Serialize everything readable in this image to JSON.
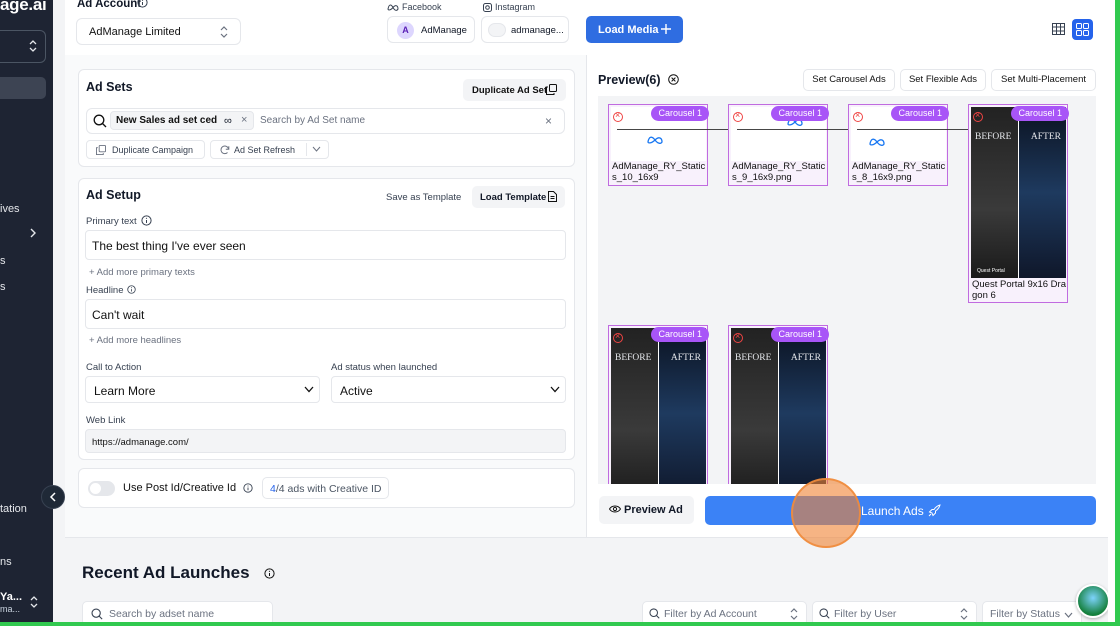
{
  "sidebar": {
    "logo": "age.ai",
    "nav_items": [
      {
        "label": "ives"
      },
      {
        "label": "s"
      },
      {
        "label": "s"
      },
      {
        "label": "tation"
      },
      {
        "label": "ns"
      }
    ],
    "profile_name": "Ya...",
    "profile_sub": "ma..."
  },
  "topbar": {
    "ad_account_label": "Ad Account",
    "ad_account_value": "AdManage Limited",
    "facebook_label": "Facebook",
    "instagram_label": "Instagram",
    "facebook_page": "AdManage",
    "instagram_account": "admanage...",
    "load_media": "Load Media"
  },
  "ad_sets": {
    "title": "Ad Sets",
    "duplicate_button": "Duplicate Ad Set",
    "selected_tag": "New Sales ad set ced",
    "search_placeholder": "Search by Ad Set name",
    "duplicate_campaign": "Duplicate Campaign",
    "refresh": "Ad Set Refresh"
  },
  "ad_setup": {
    "title": "Ad Setup",
    "save_template": "Save as Template",
    "load_template": "Load Template",
    "primary_text_label": "Primary text",
    "primary_text_value": "The best thing I've ever seen",
    "add_primary": "+ Add more primary texts",
    "headline_label": "Headline",
    "headline_value": "Can't wait",
    "add_headline": "+ Add more headlines",
    "cta_label": "Call to Action",
    "cta_value": "Learn More",
    "status_label": "Ad status when launched",
    "status_value": "Active",
    "weblink_label": "Web Link",
    "weblink_value": "https://admanage.com/"
  },
  "post_id": {
    "label": "Use Post Id/Creative Id",
    "count": "4",
    "total": "/4",
    "suffix": " ads with Creative ID",
    "toggle_on": false
  },
  "preview": {
    "title": "Preview(6)",
    "set_carousel": "Set Carousel Ads",
    "set_flexible": "Set Flexible Ads",
    "set_multi": "Set Multi-Placement",
    "tiles": [
      {
        "badge": "Carousel 1",
        "caption": "AdManage_RY_Static s_10_16x9",
        "kind": "meta"
      },
      {
        "badge": "Carousel 1",
        "caption": "AdManage_RY_Static s_9_16x9.png",
        "kind": "meta"
      },
      {
        "badge": "Carousel 1",
        "caption": "AdManage_RY_Static s_8_16x9.png",
        "kind": "meta"
      },
      {
        "badge": "Carousel 1",
        "caption": "Quest Portal 9x16 Dragon 6",
        "kind": "beforeafter"
      },
      {
        "badge": "Carousel 1",
        "caption": "",
        "kind": "beforeafter"
      },
      {
        "badge": "Carousel 1",
        "caption": "",
        "kind": "beforeafter"
      }
    ],
    "before": "BEFORE",
    "after": "AFTER",
    "brand": "Quest Portal",
    "preview_ad": "Preview Ad",
    "launch_ads": "Launch Ads"
  },
  "recent": {
    "title": "Recent Ad Launches",
    "search_placeholder": "Search by adset name",
    "filter_account": "Filter by Ad Account",
    "filter_user": "Filter by User",
    "filter_status": "Filter by Status"
  },
  "colors": {
    "primary_blue": "#2f6de1",
    "launch_blue": "#3b82f6",
    "badge_purple": "#a855f7",
    "sidebar_bg": "#1e2433",
    "frame_green": "#31c94f"
  }
}
